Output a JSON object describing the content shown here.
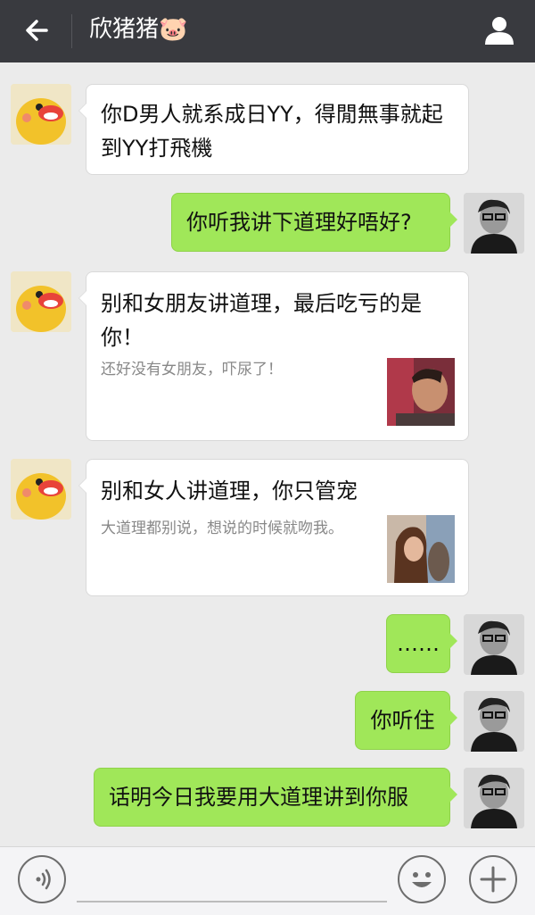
{
  "header": {
    "title": "欣猪猪🐷"
  },
  "messages": [
    {
      "side": "left",
      "text": "你D男人就系成日YY，得閒無事就起到YY打飛機"
    },
    {
      "side": "right",
      "text": "你听我讲下道理好唔好?"
    },
    {
      "side": "left",
      "type": "card",
      "title": "别和女朋友讲道理，最后吃亏的是你！",
      "subtitle": "还好没有女朋友，吓尿了！"
    },
    {
      "side": "left",
      "type": "card",
      "title": "别和女人讲道理，你只管宠",
      "subtitle": "大道理都别说，想说的时候就吻我。"
    },
    {
      "side": "right",
      "text": "……"
    },
    {
      "side": "right",
      "text": "你听住"
    },
    {
      "side": "right",
      "text": "话明今日我要用大道理讲到你服"
    }
  ],
  "icons": {
    "back": "arrow-left-icon",
    "profile": "person-icon",
    "voice": "voice-icon",
    "emoji": "smiley-icon",
    "more": "plus-icon"
  },
  "colors": {
    "header_bg": "#393a3f",
    "chat_bg": "#ebebeb",
    "sent_bubble": "#a0e759",
    "received_bubble": "#ffffff"
  }
}
